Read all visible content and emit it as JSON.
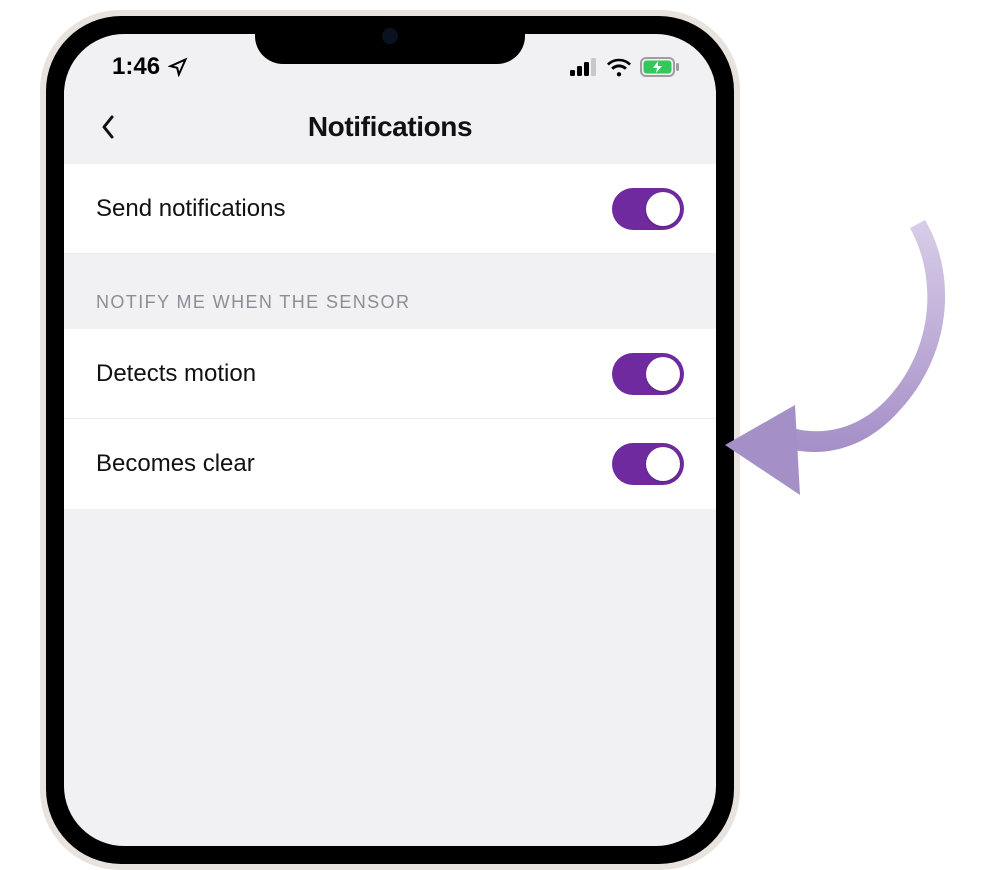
{
  "status": {
    "time": "1:46",
    "location_icon": "location-arrow"
  },
  "nav": {
    "title": "Notifications",
    "back_icon": "chevron-left"
  },
  "rows": {
    "send_notifications": {
      "label": "Send notifications",
      "on": true
    },
    "section_header": "NOTIFY ME WHEN THE SENSOR",
    "detects_motion": {
      "label": "Detects motion",
      "on": true
    },
    "becomes_clear": {
      "label": "Becomes clear",
      "on": true
    }
  },
  "colors": {
    "toggle_on": "#6e2a9e",
    "arrow": "#b3a2d1"
  }
}
